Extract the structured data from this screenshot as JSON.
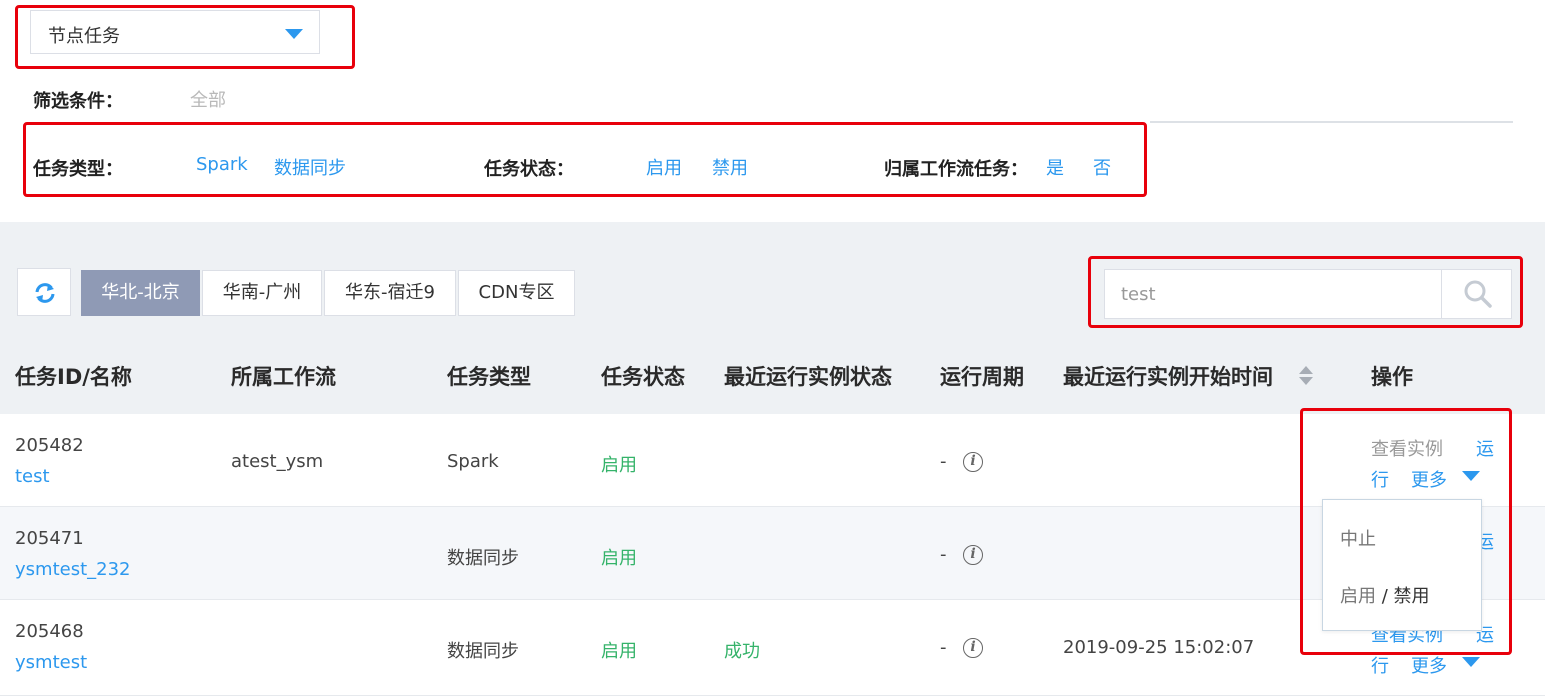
{
  "filter": {
    "task_select_value": "节点任务",
    "conditions_label": "筛选条件：",
    "conditions_value": "全部",
    "task_type_label": "任务类型：",
    "task_type_options": [
      "Spark",
      "数据同步"
    ],
    "task_status_label": "任务状态：",
    "task_status_options": [
      "启用",
      "禁用"
    ],
    "workflow_label": "归属工作流任务：",
    "workflow_options": [
      "是",
      "否"
    ]
  },
  "toolbar": {
    "refresh_icon": "refresh-icon",
    "regions": [
      "华北-北京",
      "华南-广州",
      "华东-宿迁9",
      "CDN专区"
    ],
    "active_region": "华北-北京",
    "search_value": "test",
    "search_icon": "search-icon"
  },
  "table": {
    "columns": [
      "任务ID/名称",
      "所属工作流",
      "任务类型",
      "任务状态",
      "最近运行实例状态",
      "运行周期",
      "最近运行实例开始时间",
      "操作"
    ],
    "rows": [
      {
        "id": "205482",
        "name": "test",
        "workflow": "atest_ysm",
        "type": "Spark",
        "status": "启用",
        "last_status": "",
        "cycle": "-",
        "start_time": ""
      },
      {
        "id": "205471",
        "name": "ysmtest_232",
        "workflow": "",
        "type": "数据同步",
        "status": "启用",
        "last_status": "",
        "cycle": "-",
        "start_time": ""
      },
      {
        "id": "205468",
        "name": "ysmtest",
        "workflow": "",
        "type": "数据同步",
        "status": "启用",
        "last_status": "成功",
        "cycle": "-",
        "start_time": "2019-09-25 15:02:07"
      }
    ],
    "actions": {
      "view_instances": "查看实例",
      "run_part1": "运",
      "run_part2": "行",
      "more": "更多"
    }
  },
  "dropdown": {
    "items": [
      "中止",
      "启用",
      "/",
      "禁用"
    ]
  },
  "colors": {
    "link": "#2c98ee",
    "enabled_green": "#35b36a",
    "active_tab": "#8f9ab5",
    "highlight_red": "#e8000b",
    "band_bg": "#eef1f4"
  }
}
